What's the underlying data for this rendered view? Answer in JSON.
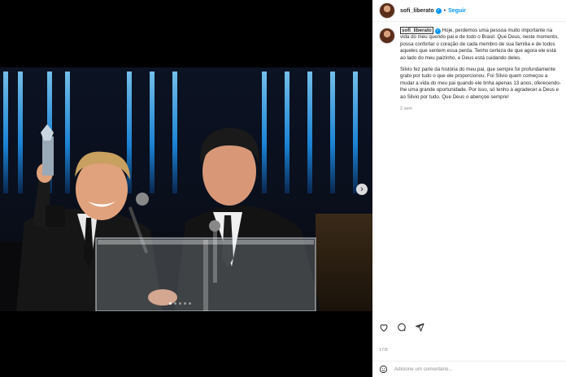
{
  "post": {
    "username": "sofi_liberato",
    "follow_label": "Seguir",
    "separator": "•",
    "caption_tag": "sofi_liberato",
    "caption_p1": "Hoje, perdemos uma pessoa muito importante na vida do meu querido pai e de todo o Brasil. Que Deus, neste momento, possa confortar o coração de cada membro de sua família e de todos aqueles que sentem essa perda. Tenho certeza de que agora ele está ao lado do meu paizinho, e Deus está cuidando deles.",
    "caption_p2": "Silvio fez parte da história do meu pai, que sempre foi profundamente grato por tudo o que ele proporcionou. Foi Silvio quem começou a mudar a vida do meu pai quando ele tinha apenas 13 anos, oferecendo-lhe uma grande oportunidade. Por isso, só tenho a agradecer a Deus e ao Silvio por tudo. Que Deus o abençoe sempre!",
    "caption_time": "2 sem",
    "date": "17/8",
    "comment_placeholder": "Adicione um comentário..."
  },
  "media": {
    "next_icon": "chevron-right-icon",
    "slides": 5,
    "active_slide": 1
  },
  "colors": {
    "accent": "#0095f6",
    "stage_lights": "#2aa8ff"
  }
}
